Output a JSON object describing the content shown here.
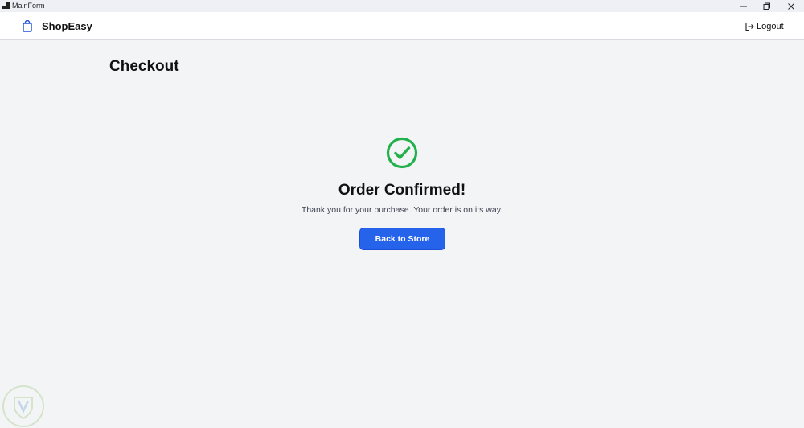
{
  "window": {
    "title": "MainForm",
    "icon": "app-window-icon",
    "controls": [
      "minimize-icon",
      "maximize-icon",
      "close-icon"
    ]
  },
  "header": {
    "brand_icon": "shopping-bag-icon",
    "brand_name": "ShopEasy",
    "logout_icon": "logout-icon",
    "logout_label": "Logout"
  },
  "page": {
    "title": "Checkout"
  },
  "confirmation": {
    "icon": "check-circle-icon",
    "title": "Order Confirmed!",
    "message": "Thank you for your purchase. Your order is on its way.",
    "button_label": "Back to Store"
  },
  "colors": {
    "accent": "#2563eb",
    "success": "#22b14c",
    "background": "#f3f4f6",
    "header_bg": "#ffffff"
  }
}
